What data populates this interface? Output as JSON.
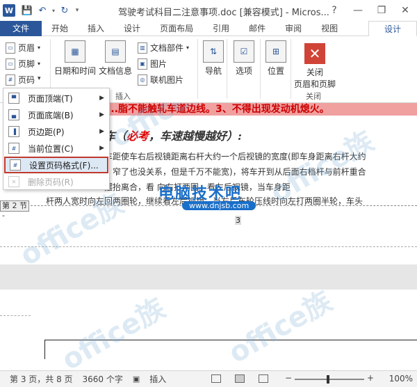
{
  "titlebar": {
    "title": "驾驶考试科目二注意事项.doc [兼容模式] - Micros...",
    "help": "?",
    "minimize": "—",
    "restore": "❐",
    "close": "✕"
  },
  "tabs": [
    "文件",
    "开始",
    "插入",
    "设计",
    "页面布局",
    "引用",
    "邮件",
    "审阅",
    "视图"
  ],
  "active_tab": "设计",
  "ribbon": {
    "header": "页眉",
    "footer": "页脚",
    "pagenum": "页码",
    "datetime": "日期和时间",
    "docinfo": "文档信息",
    "docparts": "文档部件",
    "picture": "图片",
    "online_picture": "联机图片",
    "insert_group": "插入",
    "navigation": "导航",
    "options": "选项",
    "position": "位置",
    "close_line1": "关闭",
    "close_line2": "页眉和页脚",
    "close_group": "关闭"
  },
  "menu": {
    "items": [
      "页面顶端(T)",
      "页面底端(B)",
      "页边距(P)",
      "当前位置(C)",
      "设置页码格式(F)...",
      "删除页码(R)"
    ]
  },
  "document": {
    "red_line": "...脂不能触轧车道边线。3、不得出现发动机熄火。",
    "heading_pre": "车（",
    "heading_red": "必考",
    "heading_post": "，车速越慢越好）:",
    "line1": "车距使车右后视镜距离右杆大约一个后视镜的宽度(即车身距离右杆大约",
    "line2": "，窄了也没关系，但是千万不能宽)，将车开到从后面右档杆与前杆重合",
    "line3": "摆抬离合，看                                   向右打两圈。看左后视镜，当车身距",
    "line4": "杆两人宽时向左回两圈轮，继续看左后视镜，当左后车轮压线时向左打两圈半轮，车头",
    "section": "第 2 节 -",
    "page_number": "3"
  },
  "watermark": {
    "main": "电脑技术吧",
    "url": "www.dnjsb.com",
    "office": "office族"
  },
  "status": {
    "page": "第 3 页，共 8 页",
    "words": "3660 个字",
    "mode": "插入",
    "zoom": "100%",
    "minus": "−",
    "plus": "+"
  }
}
